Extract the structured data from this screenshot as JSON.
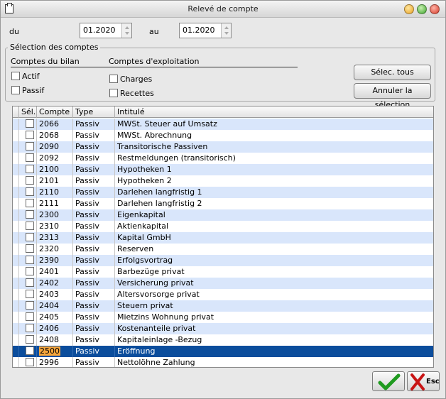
{
  "window": {
    "title": "Relevé de compte"
  },
  "period": {
    "from_label": "du",
    "from_value": "01.2020",
    "to_label": "au",
    "to_value": "01.2020"
  },
  "selection": {
    "group_title": "Sélection des comptes",
    "bilan_heading": "Comptes du bilan",
    "exploitation_heading": "Comptes d'exploitation",
    "actif_label": "Actif",
    "passif_label": "Passif",
    "charges_label": "Charges",
    "recettes_label": "Recettes",
    "select_all_label": "Sélec. tous",
    "cancel_selection_label": "Annuler la sélection"
  },
  "table": {
    "columns": [
      "Sél.",
      "Compte",
      "Type",
      "Intitulé"
    ],
    "rows": [
      {
        "compte": "2066",
        "type": "Passiv",
        "intitule": "MWSt. Steuer auf Umsatz"
      },
      {
        "compte": "2068",
        "type": "Passiv",
        "intitule": "MWSt. Abrechnung"
      },
      {
        "compte": "2090",
        "type": "Passiv",
        "intitule": "Transitorische Passiven"
      },
      {
        "compte": "2092",
        "type": "Passiv",
        "intitule": "Restmeldungen (transitorisch)"
      },
      {
        "compte": "2100",
        "type": "Passiv",
        "intitule": "Hypotheken 1"
      },
      {
        "compte": "2101",
        "type": "Passiv",
        "intitule": "Hypotheken 2"
      },
      {
        "compte": "2110",
        "type": "Passiv",
        "intitule": "Darlehen langfristig 1"
      },
      {
        "compte": "2111",
        "type": "Passiv",
        "intitule": "Darlehen langfristig 2"
      },
      {
        "compte": "2300",
        "type": "Passiv",
        "intitule": "Eigenkapital"
      },
      {
        "compte": "2310",
        "type": "Passiv",
        "intitule": "Aktienkapital"
      },
      {
        "compte": "2313",
        "type": "Passiv",
        "intitule": "Kapital GmbH"
      },
      {
        "compte": "2320",
        "type": "Passiv",
        "intitule": "Reserven"
      },
      {
        "compte": "2390",
        "type": "Passiv",
        "intitule": "Erfolgsvortrag"
      },
      {
        "compte": "2401",
        "type": "Passiv",
        "intitule": "Barbezüge privat"
      },
      {
        "compte": "2402",
        "type": "Passiv",
        "intitule": "Versicherung privat"
      },
      {
        "compte": "2403",
        "type": "Passiv",
        "intitule": "Altersvorsorge privat"
      },
      {
        "compte": "2404",
        "type": "Passiv",
        "intitule": "Steuern privat"
      },
      {
        "compte": "2405",
        "type": "Passiv",
        "intitule": "Mietzins Wohnung privat"
      },
      {
        "compte": "2406",
        "type": "Passiv",
        "intitule": "Kostenanteile privat"
      },
      {
        "compte": "2408",
        "type": "Passiv",
        "intitule": "Kapitaleinlage -Bezug"
      },
      {
        "compte": "2500",
        "type": "Passiv",
        "intitule": "Eröffnung",
        "selected": true
      },
      {
        "compte": "2996",
        "type": "Passiv",
        "intitule": "Nettolöhne Zahlung"
      }
    ]
  },
  "footer": {
    "esc_label": "Esc"
  },
  "colors": {
    "row_alt": "#d9e6fb",
    "row_selected": "#0b4d9c",
    "compte_highlight": "#f6a53b",
    "ok_green": "#1f9a1f",
    "esc_red": "#c81414"
  }
}
